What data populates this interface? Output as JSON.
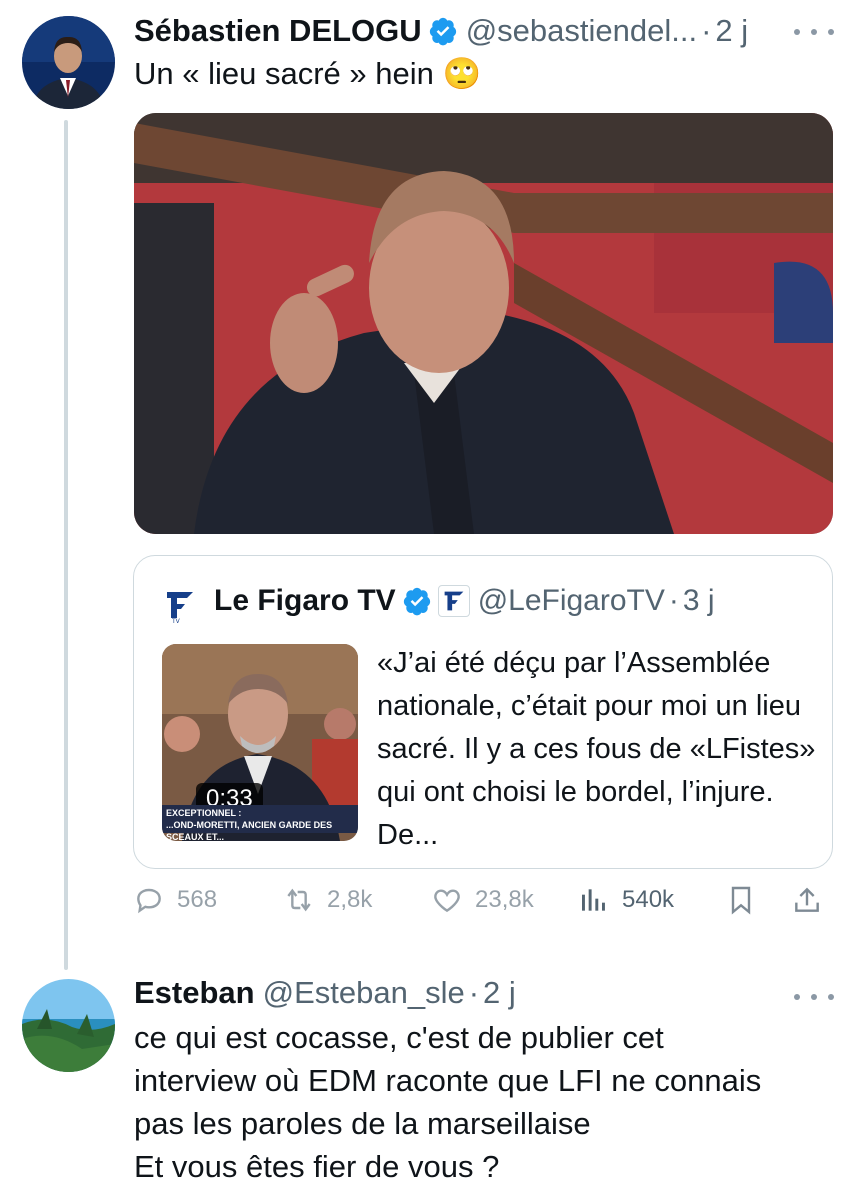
{
  "tweet1": {
    "name": "Sébastien DELOGU",
    "handle": "@sebastiendel...",
    "dot": "·",
    "time": "2 j",
    "text": "Un « lieu sacré » hein 🙄"
  },
  "quote": {
    "name": "Le Figaro TV",
    "handle": "@LeFigaroTV",
    "dot": "·",
    "time": "3 j",
    "text": "«J’ai été déçu par l’Assemblée nationale, c’était pour moi un lieu sacré. Il y a ces fous de «LFistes» qui ont choisi le bordel, l’injure. De...",
    "video_duration": "0:33",
    "chyron_line1": "EXCEPTIONNEL :",
    "chyron_line2": "...OND-MORETTI, ANCIEN GARDE DES SCEAUX ET..."
  },
  "actions": {
    "replies": "568",
    "reposts": "2,8k",
    "likes": "23,8k",
    "views": "540k"
  },
  "tweet2": {
    "name": "Esteban",
    "handle": "@Esteban_sle",
    "dot": "·",
    "time": "2 j",
    "text_lines": [
      "ce qui est cocasse, c'est de publier cet",
      "interview où EDM raconte que LFI ne connais",
      "pas les paroles de la marseillaise",
      "Et vous êtes fier de vous ?"
    ]
  },
  "colors": {
    "verified": "#1d9bf0",
    "muted": "#536471",
    "border": "#cfd9de"
  }
}
